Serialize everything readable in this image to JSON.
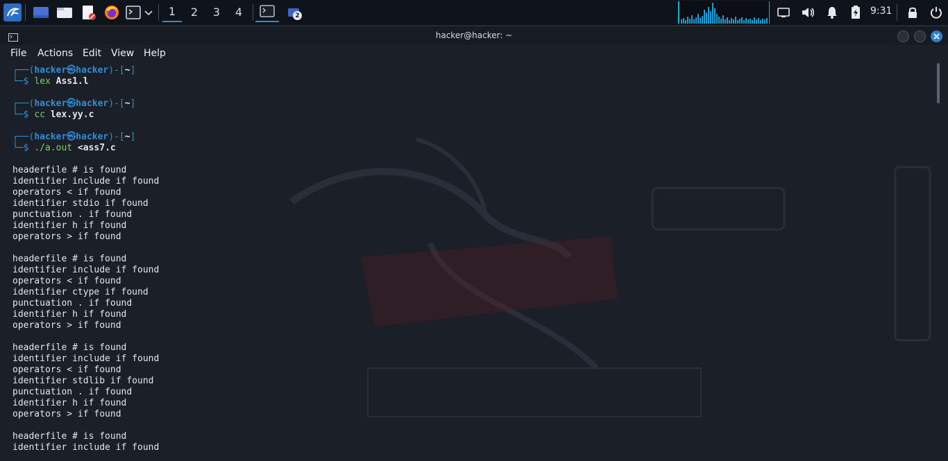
{
  "panel": {
    "workspaces": [
      "1",
      "2",
      "3",
      "4"
    ],
    "active_workspace": "1",
    "taskbar_badge": "2",
    "clock": "9:31",
    "icons": [
      "kali-menu-icon",
      "show-desktop-icon",
      "file-manager-icon",
      "text-editor-icon",
      "firefox-icon",
      "terminal-icon",
      "dropdown-chevron-icon",
      "terminal-task-icon",
      "screenshot-task-icon",
      "cpu-graph",
      "network-icon",
      "volume-icon",
      "notifications-bell-icon",
      "battery-icon",
      "lock-icon",
      "power-icon"
    ]
  },
  "window": {
    "title": "hacker@hacker: ~",
    "menu": [
      "File",
      "Actions",
      "Edit",
      "View",
      "Help"
    ]
  },
  "terminal": {
    "prompt": {
      "user": "hacker",
      "host": "hacker",
      "at": "㉿",
      "dir": "~"
    },
    "commands": [
      {
        "cmd": "lex",
        "arg": "Ass1.l"
      },
      {
        "cmd": "cc",
        "arg": "lex.yy.c"
      },
      {
        "cmd": "./a.out",
        "arg": "<ass7.c"
      }
    ],
    "output": [
      "headerfile # is found",
      "identifier include if found",
      "operators < if found",
      "identifier stdio if found",
      "punctuation . if found",
      "identifier h if found",
      "operators > if found",
      "",
      "headerfile # is found",
      "identifier include if found",
      "operators < if found",
      "identifier ctype if found",
      "punctuation . if found",
      "identifier h if found",
      "operators > if found",
      "",
      "headerfile # is found",
      "identifier include if found",
      "operators < if found",
      "identifier stdlib if found",
      "punctuation . if found",
      "identifier h if found",
      "operators > if found",
      "",
      "headerfile # is found",
      "identifier include if found"
    ]
  },
  "colors": {
    "accent": "#2f8fd8",
    "prompt_cmd": "#7ad36b",
    "close_button": "#2d7fd6",
    "background": "#1b1f27"
  }
}
